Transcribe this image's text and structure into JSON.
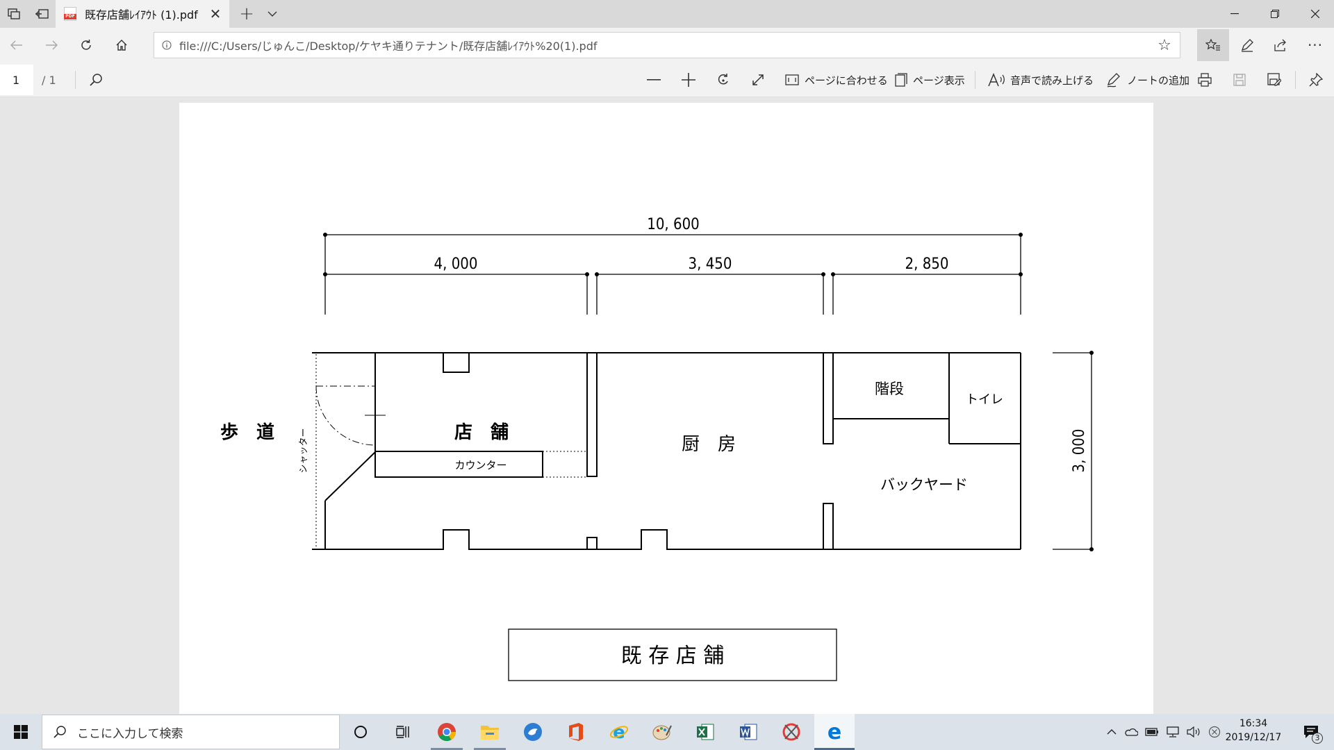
{
  "browser": {
    "tab": {
      "title": "既存店舗ﾚｲｱｳﾄ (1).pdf"
    },
    "address": {
      "url": "file:///C:/Users/じゅんこ/Desktop/ケヤキ通りテナント/既存店舗ﾚｲｱｳﾄ%20(1).pdf"
    }
  },
  "pdf_toolbar": {
    "page_number": "1",
    "page_total": "/ 1",
    "fit_page_label": "ページに合わせる",
    "page_view_label": "ページ表示",
    "read_aloud_label": "音声で読み上げる",
    "add_notes_label": "ノートの追加"
  },
  "floor_plan": {
    "total_width_dim": "10, 600",
    "segment_dims": [
      "4, 000",
      "3, 450",
      "2, 850"
    ],
    "depth_dim": "3, 000",
    "sidewalk": "歩　道",
    "shutter": "シャッター",
    "store_room": "店　舗",
    "counter": "カウンター",
    "kitchen": "厨　房",
    "stairs": "階段",
    "toilet": "トイレ",
    "backyard": "バックヤード",
    "title": "既 存 店 舗"
  },
  "taskbar": {
    "search_placeholder": "ここに入力して検索",
    "time": "16:34",
    "date": "2019/12/17",
    "notification_count": "3"
  }
}
